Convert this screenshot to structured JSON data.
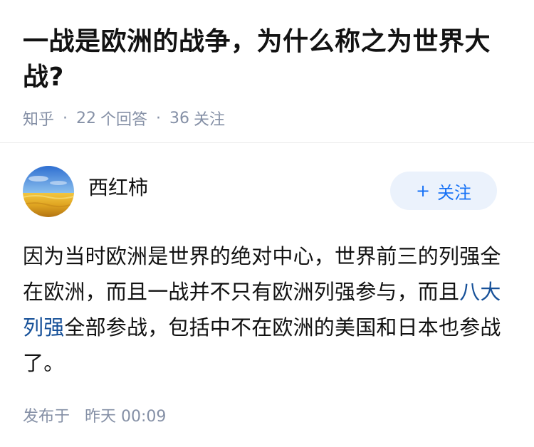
{
  "question": {
    "title": "一战是欧洲的战争，为什么称之为世界大战?",
    "source": "知乎",
    "separator": "·",
    "answer_count": "22",
    "answer_label": "个回答",
    "follow_count": "36",
    "follow_label": "关注"
  },
  "answer": {
    "author_name": "西红柿",
    "follow_button_plus": "+",
    "follow_button_label": "关注",
    "content": {
      "part1": "因为当时欧洲是世界的绝对中心，世界前三的列强全在欧洲，而且一战并不只有欧洲列强参与，而且",
      "link": "八大列强",
      "part2": "全部参战，包括中不在欧洲的美国和日本也参战了。"
    },
    "publish_label": "发布于",
    "publish_time": "昨天 00:09"
  },
  "colors": {
    "title": "#121212",
    "meta": "#8590a6",
    "link": "#175199",
    "follow_bg": "#ebf2fc",
    "follow_text": "#1772f6"
  }
}
